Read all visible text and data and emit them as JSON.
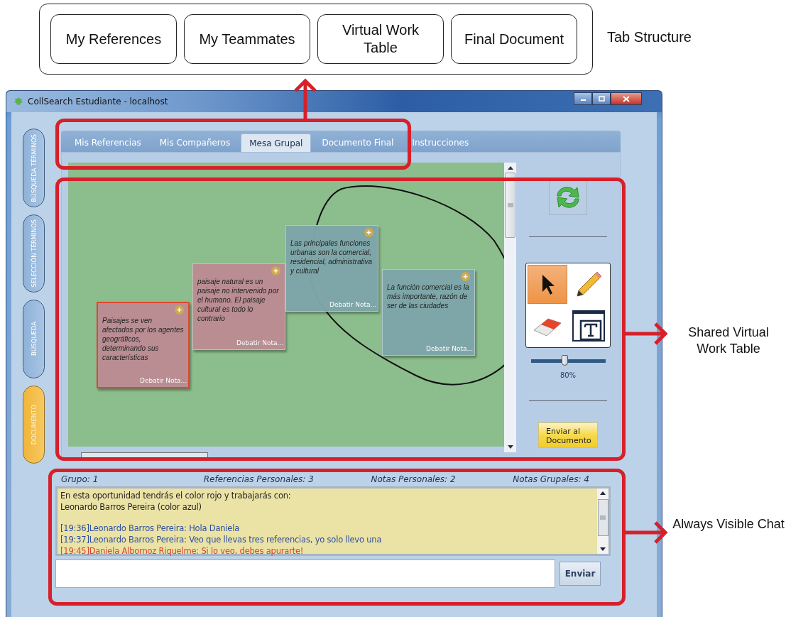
{
  "annotations": {
    "tab_labels": [
      "My References",
      "My Teammates",
      "Virtual Work Table",
      "Final Document"
    ],
    "tab_caption": "Tab Structure",
    "callouts": [
      "Shared Virtual Work Table",
      "Always Visible Chat"
    ]
  },
  "window": {
    "title": "CollSearch Estudiante - localhost"
  },
  "side_tabs": [
    {
      "label": "BÚSQUEDA TÉRMINOS",
      "selected": false
    },
    {
      "label": "SELECCIÓN TÉRMINOS",
      "selected": false
    },
    {
      "label": "BÚSQUEDA",
      "selected": false
    },
    {
      "label": "DOCUMENTO",
      "selected": true
    }
  ],
  "tabs": [
    {
      "label": "Mis Referencias",
      "selected": false
    },
    {
      "label": "Mis Compañeros",
      "selected": false
    },
    {
      "label": "Mesa Grupal",
      "selected": true
    },
    {
      "label": "Documento Final",
      "selected": false
    },
    {
      "label": "Instrucciones",
      "selected": false
    }
  ],
  "notes": [
    {
      "text": "Paisajes se ven afectados por los agentes geográficos, determinando sus características",
      "footer": "Debatir Nota...",
      "color": "#bb8c93",
      "selected": true
    },
    {
      "text": "paisaje natural es un paisaje no intervenido por el humano. El paisaje cultural es todo lo contrario",
      "footer": "Debatir Nota...",
      "color": "#bb8c93",
      "selected": false
    },
    {
      "text": "Las principales funciones urbanas son la comercial, residencial, administrativa y cultural",
      "footer": "Debatir Nota...",
      "color": "#7ea6aa",
      "selected": false
    },
    {
      "text": "La función comercial es la más importante, razón de ser de las ciudades",
      "footer": "Debatir Nota...",
      "color": "#7ea6aa",
      "selected": false
    }
  ],
  "tools": [
    {
      "kind": "pointer",
      "selected": true
    },
    {
      "kind": "pencil",
      "selected": false
    },
    {
      "kind": "eraser",
      "selected": false
    },
    {
      "kind": "text",
      "selected": false
    }
  ],
  "zoom": {
    "level": 0.45,
    "reading": "80%"
  },
  "send_to_document_button": "Enviar al Documento",
  "stats": [
    "Grupo: 1",
    "Referencias Personales: 3",
    "Notas Personales: 2",
    "Notas Grupales: 4"
  ],
  "chat": {
    "messages": [
      {
        "kind": "system",
        "text": "En esta oportunidad tendrás el color rojo y trabajarás con:",
        "color": "#1e1e1e"
      },
      {
        "kind": "system",
        "text": "Leonardo Barros Pereira (color azul)",
        "color": "#1e1e1e"
      },
      {
        "kind": "message",
        "text": "[19:36]Leonardo Barros Pereira: Hola Daniela",
        "color": "#2d4f9e"
      },
      {
        "kind": "message",
        "text": "[19:37]Leonardo Barros Pereira: Veo que llevas tres referencias, yo solo llevo una",
        "color": "#2d4f9e"
      },
      {
        "kind": "message",
        "text": "[19:45]Daniela Albornoz Riquelme: Si lo veo, debes apurarte!",
        "color": "#d9432f"
      }
    ]
  },
  "send_button": "Enviar"
}
